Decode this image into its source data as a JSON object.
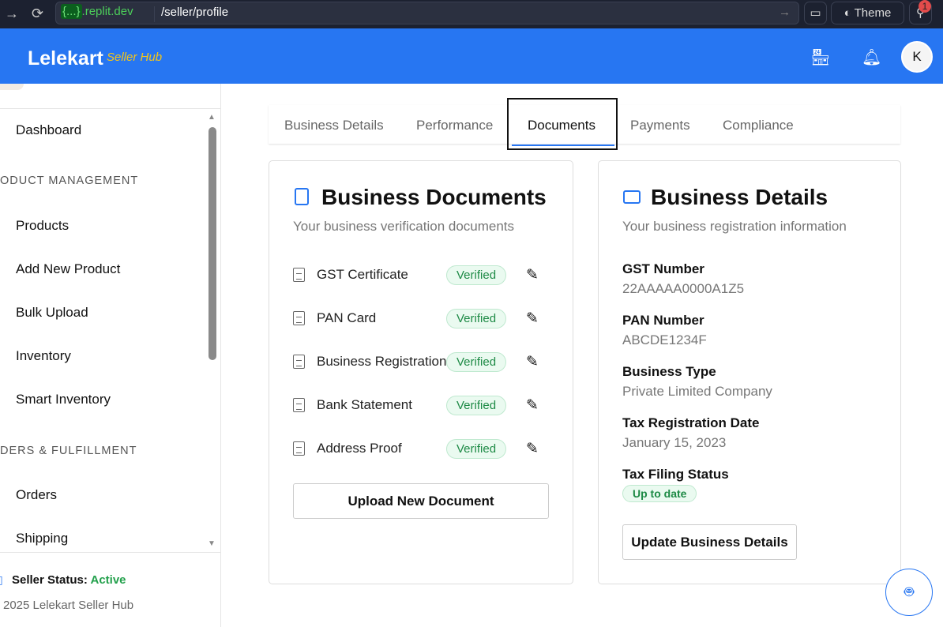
{
  "browser": {
    "host_badge": "{...}",
    "host": ".replit.dev",
    "path": "/seller/profile",
    "theme_label": "Theme",
    "notif_count": "1"
  },
  "header": {
    "logo": "Lelekart",
    "logo_sub": "Seller Hub",
    "avatar_initial": "K"
  },
  "sidebar": {
    "dashboard": "Dashboard",
    "section_products": "ODUCT MANAGEMENT",
    "items_products": [
      "Products",
      "Add New Product",
      "Bulk Upload",
      "Inventory",
      "Smart Inventory"
    ],
    "section_orders": "DERS & FULFILLMENT",
    "items_orders": [
      "Orders",
      "Shipping"
    ],
    "status_label": "Seller Status:",
    "status_value": "Active",
    "copyright": "2025 Lelekart Seller Hub"
  },
  "tabs": [
    "Business Details",
    "Performance",
    "Documents",
    "Payments",
    "Compliance"
  ],
  "documents": {
    "title": "Business Documents",
    "subtitle": "Your business verification documents",
    "items": [
      {
        "name": "GST Certificate",
        "status": "Verified"
      },
      {
        "name": "PAN Card",
        "status": "Verified"
      },
      {
        "name": "Business Registration",
        "status": "Verified"
      },
      {
        "name": "Bank Statement",
        "status": "Verified"
      },
      {
        "name": "Address Proof",
        "status": "Verified"
      }
    ],
    "upload_label": "Upload New Document"
  },
  "details": {
    "title": "Business Details",
    "subtitle": "Your business registration information",
    "fields": [
      {
        "label": "GST Number",
        "value": "22AAAAA0000A1Z5"
      },
      {
        "label": "PAN Number",
        "value": "ABCDE1234F"
      },
      {
        "label": "Business Type",
        "value": "Private Limited Company"
      },
      {
        "label": "Tax Registration Date",
        "value": "January 15, 2023"
      }
    ],
    "filing_label": "Tax Filing Status",
    "filing_value": "Up to date",
    "update_label": "Update Business Details"
  },
  "colors": {
    "brand": "#2776f2",
    "accent": "#f5c518",
    "success": "#22a04b"
  }
}
